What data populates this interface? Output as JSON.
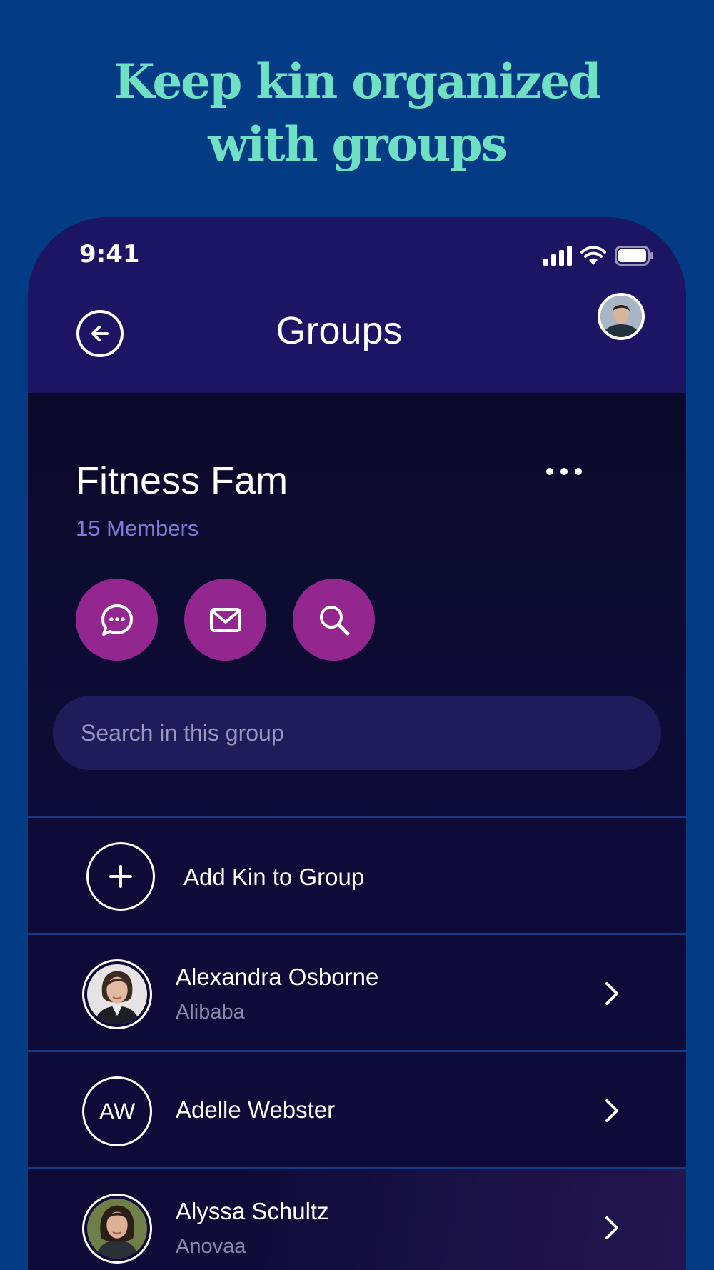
{
  "headline": {
    "line1": "Keep kin organized",
    "line2": "with groups"
  },
  "status_bar": {
    "time": "9:41",
    "icons": [
      "cellular-signal-icon",
      "wifi-icon",
      "battery-icon"
    ]
  },
  "header": {
    "title": "Groups",
    "back_icon": "back-arrow-icon",
    "profile_icon": "profile-avatar"
  },
  "group": {
    "name": "Fitness Fam",
    "member_count": "15 Members",
    "more_icon": "more-icon",
    "actions": [
      {
        "icon": "chat-icon"
      },
      {
        "icon": "mail-icon"
      },
      {
        "icon": "search-icon"
      }
    ],
    "search_placeholder": "Search in this group"
  },
  "add_kin": {
    "label": "Add Kin to Group",
    "icon": "plus-icon"
  },
  "members": [
    {
      "name": "Alexandra Osborne",
      "company": "Alibaba",
      "avatar": "photo"
    },
    {
      "name": "Adelle Webster",
      "company": "",
      "initials": "AW",
      "avatar": "initials"
    },
    {
      "name": "Alyssa Schultz",
      "company": "Anovaa",
      "avatar": "photo"
    }
  ],
  "colors": {
    "background": "#033b84",
    "headline": "#6fe0c4",
    "header": "#1c1564",
    "surface": "#0e0b38",
    "action_button": "#94278f",
    "member_count": "#7f7bd6",
    "divider": "#163b86"
  }
}
